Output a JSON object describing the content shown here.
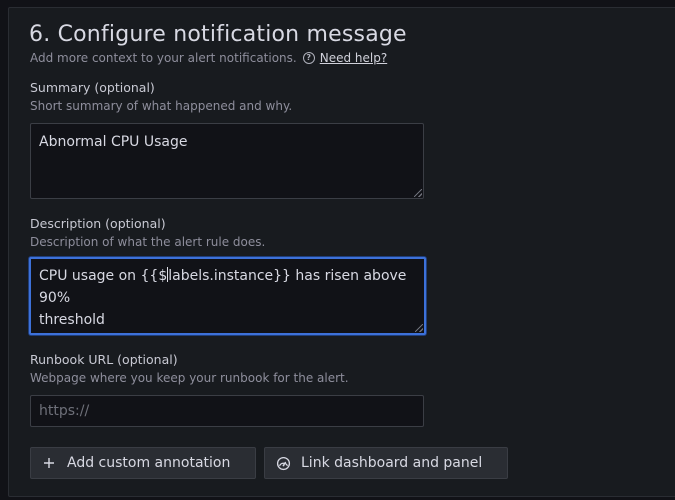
{
  "section": {
    "title": "6. Configure notification message",
    "subtitle": "Add more context to your alert notifications.",
    "help_label": "Need help?",
    "help_icon": "question-circle-icon"
  },
  "summary": {
    "label": "Summary (optional)",
    "description": "Short summary of what happened and why.",
    "value": "Abnormal CPU Usage"
  },
  "description": {
    "label": "Description (optional)",
    "description": "Description of what the alert rule does.",
    "value_before_caret": "CPU usage on {{$",
    "value_after_caret": "labels.instance}} has risen above 90%",
    "value_line2": "threshold"
  },
  "runbook": {
    "label": "Runbook URL (optional)",
    "description": "Webpage where you keep your runbook for the alert.",
    "placeholder": "https://",
    "value": ""
  },
  "buttons": {
    "add_annotation": "Add custom annotation",
    "link_dashboard": "Link dashboard and panel"
  },
  "colors": {
    "background": "#111217",
    "panel": "#181b1f",
    "focus_border": "#3d71d9"
  }
}
